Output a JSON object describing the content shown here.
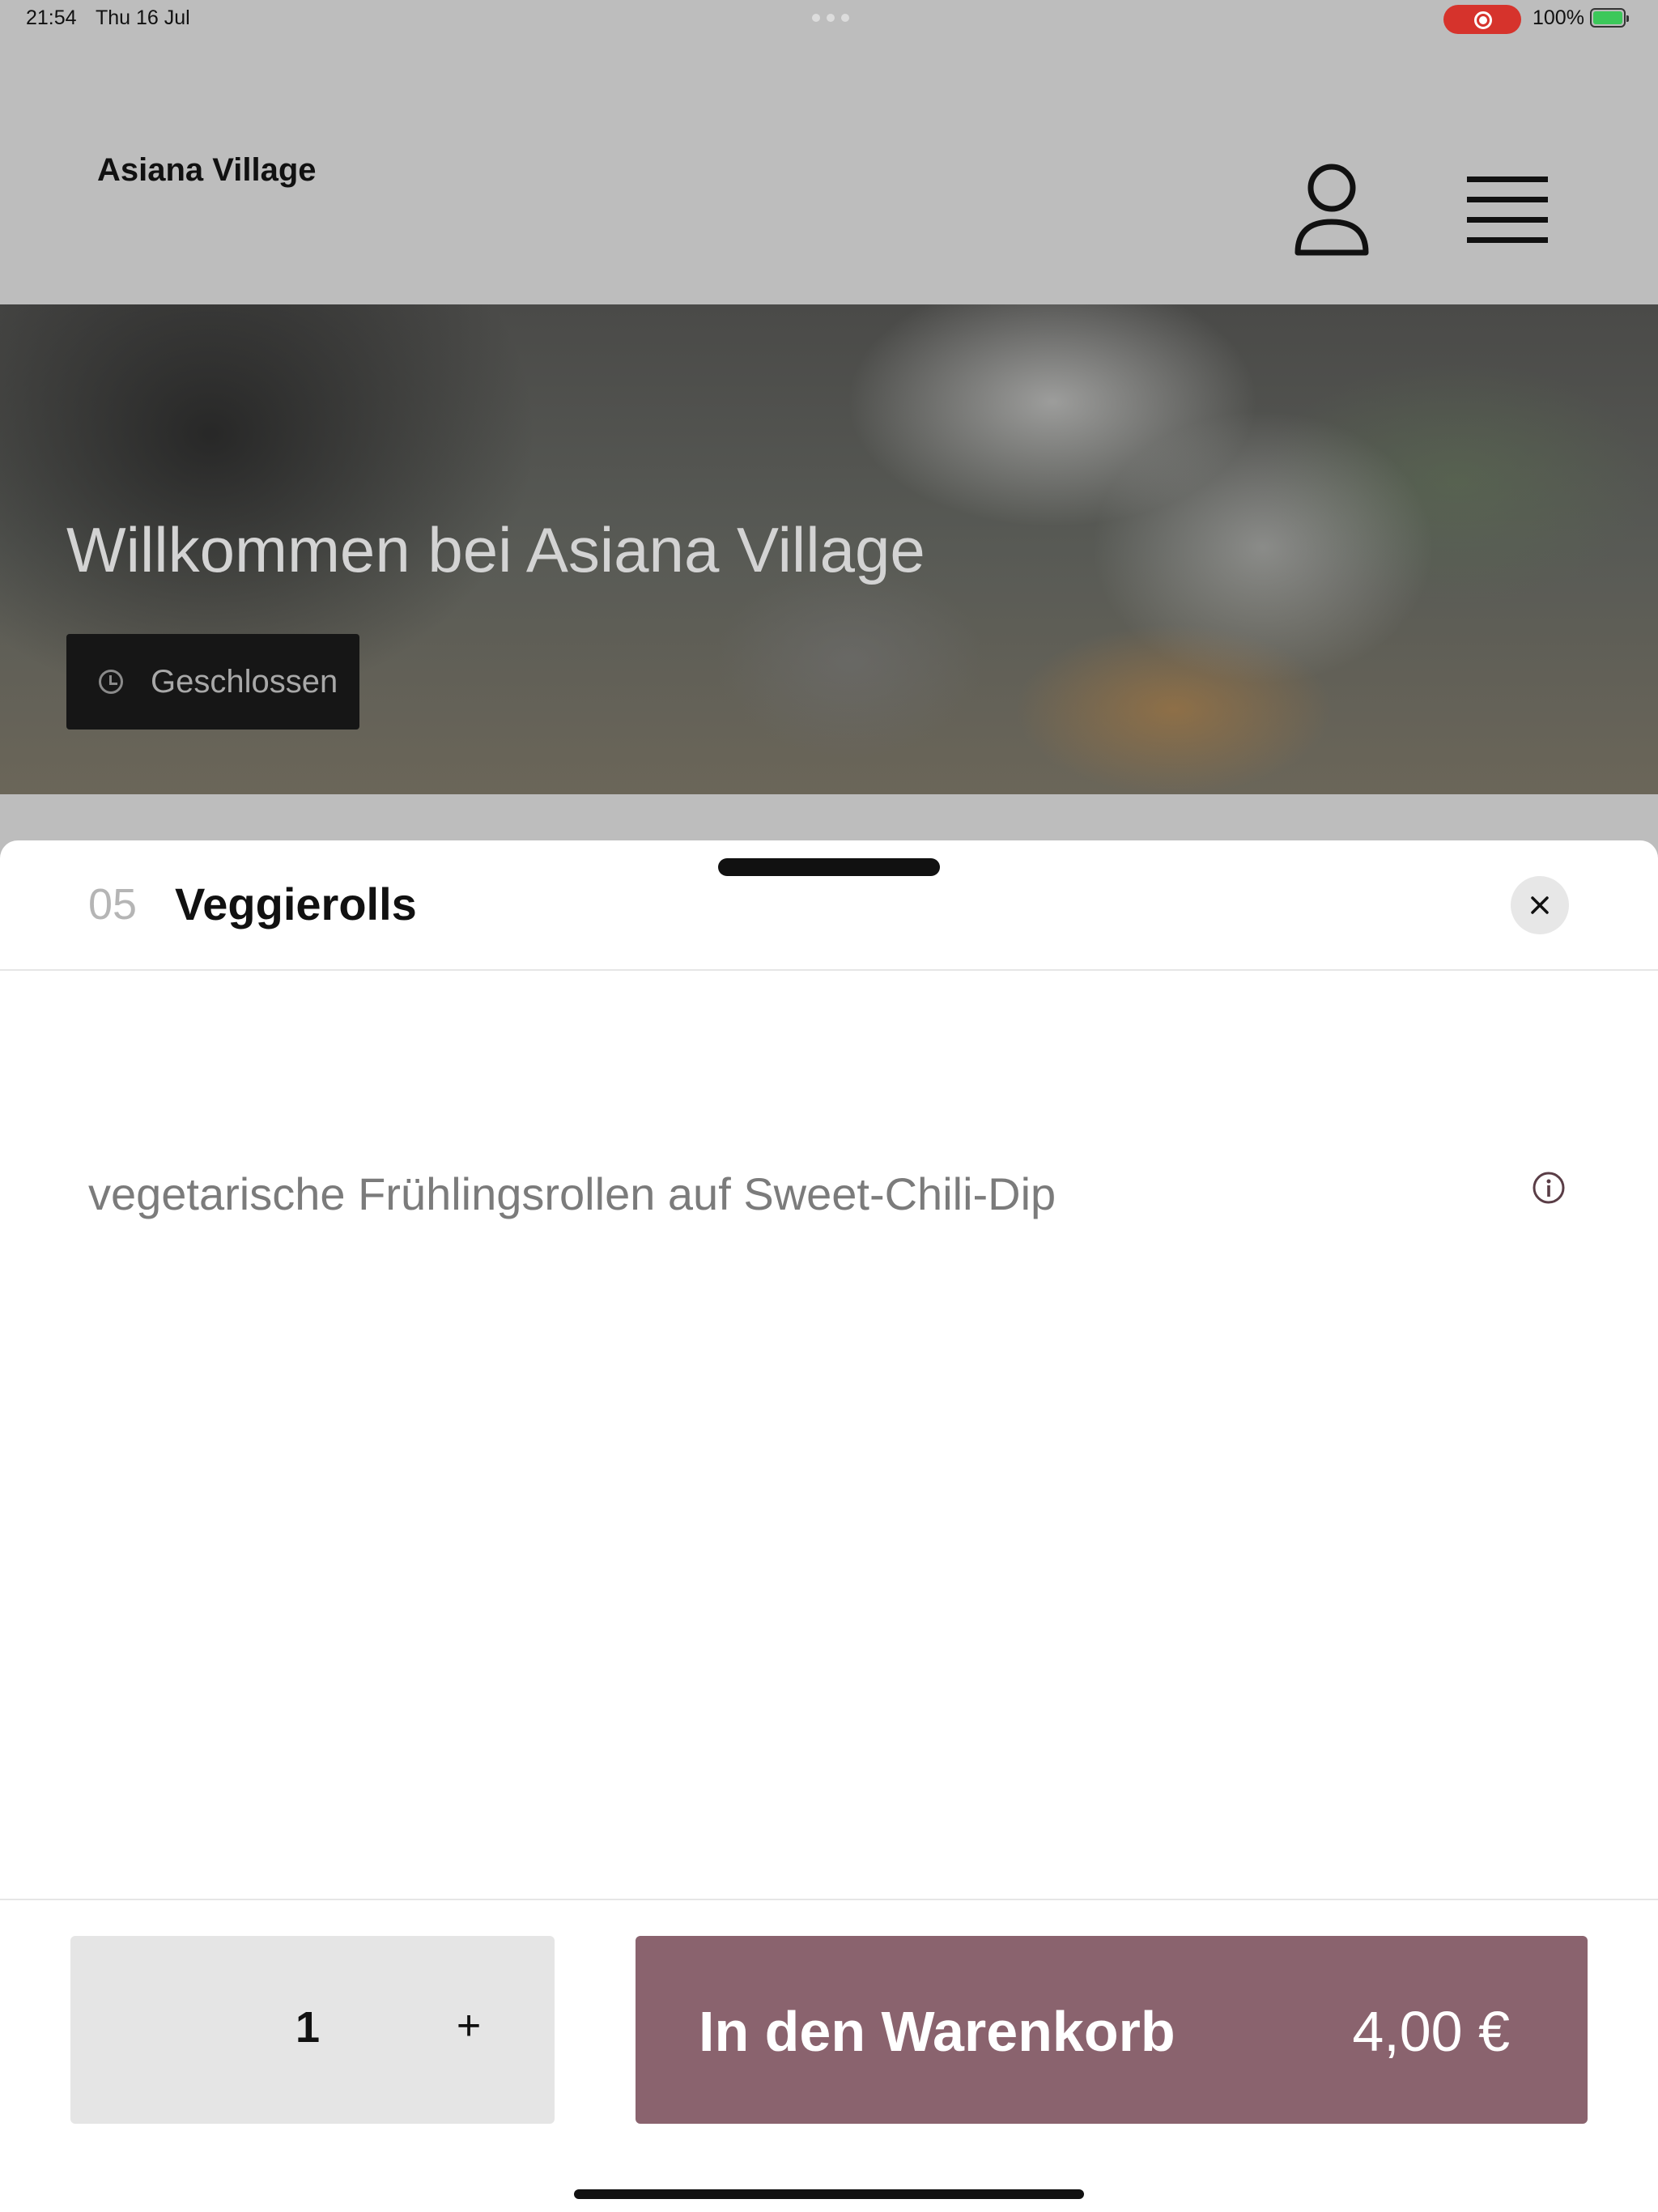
{
  "status_bar": {
    "time": "21:54",
    "date": "Thu 16 Jul",
    "battery_percent": "100%",
    "recording_color": "#d6332c"
  },
  "header": {
    "brand": "Asiana Village",
    "user_icon": "user-icon",
    "menu_icon": "hamburger-menu-icon"
  },
  "hero": {
    "title": "Willkommen bei Asiana Village",
    "status_label": "Geschlossen",
    "status_icon": "clock-icon"
  },
  "sheet": {
    "item_number": "05",
    "item_title": "Veggierolls",
    "description": "vegetarische Frühlingsrollen auf Sweet-Chili-Dip",
    "close_icon": "close-icon",
    "info_icon": "info-icon"
  },
  "footer": {
    "quantity": "1",
    "plus_label": "+",
    "cart_label": "In den Warenkorb",
    "price": "4,00 €",
    "accent_color": "#8a636e"
  }
}
